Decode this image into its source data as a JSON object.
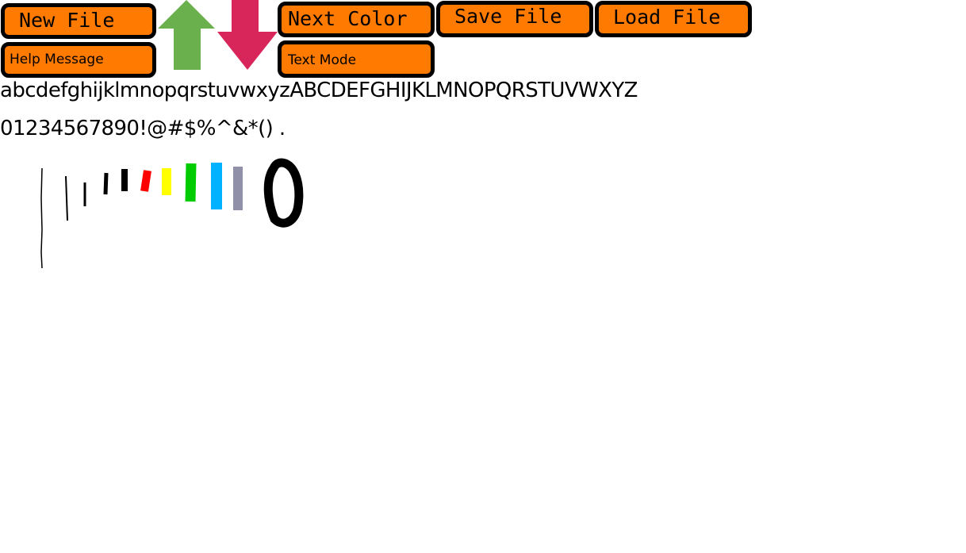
{
  "toolbar": {
    "new_file": "New File",
    "help_message": "Help Message",
    "next_color": "Next Color",
    "text_mode": "Text Mode",
    "save_file": "Save File",
    "load_file": "Load File",
    "up_arrow_icon": "up-arrow-icon",
    "down_arrow_icon": "down-arrow-icon"
  },
  "character_reference": {
    "letters": "abcdefghijklmnopqrstuvwxyzABCDEFGHIJKLMNOPQRSTUVWXYZ",
    "symbols": "01234567890!@#$%^&*() ."
  },
  "colors": {
    "button_fill": "#ff7a00",
    "button_border": "#000000",
    "up_arrow": "#6ab04c",
    "down_arrow": "#d9265a",
    "palette": [
      "#000000",
      "#000000",
      "#000000",
      "#000000",
      "#ff0000",
      "#ffff00",
      "#00cc00",
      "#00b2ff",
      "#9090a8"
    ]
  }
}
